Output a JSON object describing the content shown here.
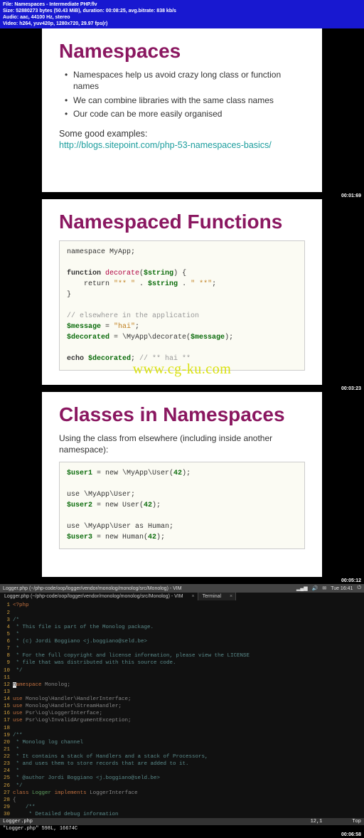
{
  "file_info": {
    "line1": "File: Namespaces - Intermediate PHP.flv",
    "line2": "Size: 52880273 bytes (50.43 MiB), duration: 00:08:25, avg.bitrate: 838 kb/s",
    "line3": "Audio: aac, 44100 Hz, stereo",
    "line4": "Video: h264, yuv420p, 1280x720, 29.97 fps(r)"
  },
  "slide1": {
    "title": "Namespaces",
    "bullets": [
      "Namespaces help us avoid crazy long class or function names",
      "We can combine libraries with the same class names",
      "Our code can be more easily organised"
    ],
    "examples_label": "Some good examples:",
    "link": "http://blogs.sitepoint.com/php-53-namespaces-basics/",
    "timestamp": "00:01:69"
  },
  "slide2": {
    "title": "Namespaced Functions",
    "code": {
      "l1": "namespace MyApp;",
      "l2": "",
      "l3a": "function ",
      "l3b": "decorate",
      "l3c": "(",
      "l3d": "$string",
      "l3e": ") {",
      "l4a": "    return ",
      "l4b": "\"** \"",
      "l4c": " . ",
      "l4d": "$string",
      "l4e": " . ",
      "l4f": "\" **\"",
      "l4g": ";",
      "l5": "}",
      "l6": "",
      "l7": "// elsewhere in the application",
      "l8a": "$message",
      "l8b": " = ",
      "l8c": "\"hai\"",
      "l8d": ";",
      "l9a": "$decorated",
      "l9b": " = \\MyApp\\decorate(",
      "l9c": "$message",
      "l9d": ");",
      "l10": "",
      "l11a": "echo ",
      "l11b": "$decorated",
      "l11c": "; ",
      "l11d": "// ** hai **"
    },
    "watermark": "www.cg-ku.com",
    "timestamp": "00:03:23"
  },
  "slide3": {
    "title": "Classes in Namespaces",
    "subtitle": "Using the class from elsewhere (including inside another namespace):",
    "code": {
      "l1a": "$user1",
      "l1b": " = new \\MyApp\\User(",
      "l1c": "42",
      "l1d": ");",
      "l2": "",
      "l3": "use \\MyApp\\User;",
      "l4a": "$user2",
      "l4b": " = new User(",
      "l4c": "42",
      "l4d": ");",
      "l5": "",
      "l6": "use \\MyApp\\User as Human;",
      "l7a": "$user3",
      "l7b": " = new Human(",
      "l7c": "42",
      "l7d": ");"
    },
    "timestamp": "00:05:12"
  },
  "terminal": {
    "window_title": "Logger.php (~/php-code/oop/logger/vendor/monolog/monolog/src/Monolog) - VIM",
    "clock": "Tue 16:41",
    "tab1": "Logger.php (~/php-code/oop/logger/vendor/monolog/monolog/src/Monolog) - VIM",
    "tab2": "Terminal",
    "lines": [
      {
        "n": "1",
        "type": "kw",
        "text": "<?php"
      },
      {
        "n": "2",
        "type": "plain",
        "text": ""
      },
      {
        "n": "3",
        "type": "cmt",
        "text": "/*"
      },
      {
        "n": "4",
        "type": "cmt",
        "text": " * This file is part of the Monolog package."
      },
      {
        "n": "5",
        "type": "cmt",
        "text": " *"
      },
      {
        "n": "6",
        "type": "cmt",
        "text": " * (c) Jordi Boggiano <j.boggiano@seld.be>"
      },
      {
        "n": "7",
        "type": "cmt",
        "text": " *"
      },
      {
        "n": "8",
        "type": "cmt",
        "text": " * For the full copyright and license information, please view the LICENSE"
      },
      {
        "n": "9",
        "type": "cmt",
        "text": " * file that was distributed with this source code."
      },
      {
        "n": "10",
        "type": "cmt",
        "text": " */"
      },
      {
        "n": "11",
        "type": "plain",
        "text": ""
      },
      {
        "n": "12",
        "type": "ns",
        "text": "namespace Monolog;"
      },
      {
        "n": "13",
        "type": "plain",
        "text": ""
      },
      {
        "n": "14",
        "type": "use",
        "text": "use Monolog\\Handler\\HandlerInterface;"
      },
      {
        "n": "15",
        "type": "use",
        "text": "use Monolog\\Handler\\StreamHandler;"
      },
      {
        "n": "16",
        "type": "use",
        "text": "use Psr\\Log\\LoggerInterface;"
      },
      {
        "n": "17",
        "type": "use",
        "text": "use Psr\\Log\\InvalidArgumentException;"
      },
      {
        "n": "18",
        "type": "plain",
        "text": ""
      },
      {
        "n": "19",
        "type": "cmt",
        "text": "/**"
      },
      {
        "n": "20",
        "type": "cmt",
        "text": " * Monolog log channel"
      },
      {
        "n": "21",
        "type": "cmt",
        "text": " *"
      },
      {
        "n": "22",
        "type": "cmt",
        "text": " * It contains a stack of Handlers and a stack of Processors,"
      },
      {
        "n": "23",
        "type": "cmt",
        "text": " * and uses them to store records that are added to it."
      },
      {
        "n": "24",
        "type": "cmt",
        "text": " *"
      },
      {
        "n": "25",
        "type": "cmt",
        "text": " * @author Jordi Boggiano <j.boggiano@seld.be>"
      },
      {
        "n": "26",
        "type": "cmt",
        "text": " */"
      },
      {
        "n": "27",
        "type": "class",
        "text": "class Logger implements LoggerInterface"
      },
      {
        "n": "28",
        "type": "plain",
        "text": "{"
      },
      {
        "n": "29",
        "type": "cmt",
        "text": "    /**"
      },
      {
        "n": "30",
        "type": "cmt",
        "text": "     * Detailed debug information"
      }
    ],
    "status_left": "Logger.php",
    "status_pos": "12,1",
    "status_right": "Top",
    "status_line2": "\"Logger.php\" 598L, 16674C",
    "timestamp": "00:06:58"
  }
}
